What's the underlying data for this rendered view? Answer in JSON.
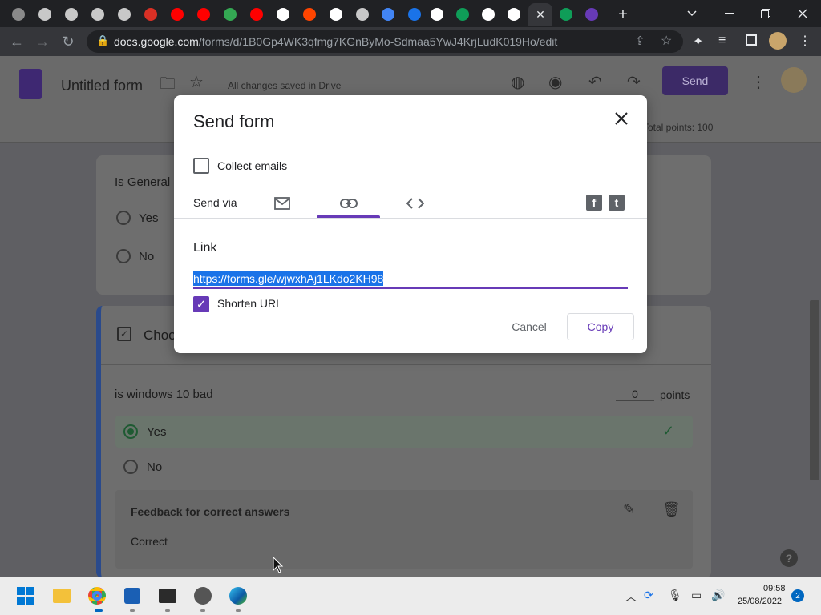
{
  "browser": {
    "url_host": "docs.google.com",
    "url_path": "/forms/d/1B0Gp4WK3qfmg7KGnByMo-Sdmaa5YwJ4KrjLudK019Ho/edit",
    "tabs": [
      {
        "icon": "tab-icon-1",
        "color": "#8a8a8a"
      },
      {
        "icon": "tab-icon-2",
        "color": "#c8c8c8"
      },
      {
        "icon": "tab-icon-3",
        "color": "#c8c8c8"
      },
      {
        "icon": "tab-icon-4",
        "color": "#c8c8c8"
      },
      {
        "icon": "tab-icon-5",
        "color": "#c8c8c8"
      },
      {
        "icon": "tab-icon-6",
        "color": "#d93025"
      },
      {
        "icon": "youtube-icon",
        "color": "#ff0000"
      },
      {
        "icon": "youtube-icon",
        "color": "#ff0000"
      },
      {
        "icon": "tab-icon-9",
        "color": "#34a853"
      },
      {
        "icon": "youtube-icon",
        "color": "#ff0000"
      },
      {
        "icon": "google-icon",
        "color": "#ffffff"
      },
      {
        "icon": "reddit-icon",
        "color": "#ff4500"
      },
      {
        "icon": "tab-icon-13",
        "color": "#ffffff"
      },
      {
        "icon": "tab-icon-14",
        "color": "#c8c8c8"
      },
      {
        "icon": "docs-icon",
        "color": "#4285f4"
      },
      {
        "icon": "tab-icon-16",
        "color": "#1a73e8"
      },
      {
        "icon": "google-icon",
        "color": "#ffffff"
      },
      {
        "icon": "tab-icon-18",
        "color": "#0f9d58"
      },
      {
        "icon": "google-icon",
        "color": "#ffffff"
      },
      {
        "icon": "tab-icon-20",
        "color": "#ffffff"
      },
      {
        "icon": "close-icon",
        "color": "#e8eaed"
      },
      {
        "icon": "tab-icon-22",
        "color": "#0f9d58"
      },
      {
        "icon": "forms-icon",
        "color": "#673ab7"
      }
    ]
  },
  "forms": {
    "title": "Untitled form",
    "saved_status": "All changes saved in Drive",
    "send_label": "Send",
    "total_points": "Total points: 100"
  },
  "background": {
    "q1_title": "Is General",
    "q1_options": [
      "Yes",
      "No"
    ],
    "section_title": "Choo",
    "q2_title": "is windows 10 bad",
    "q2_points_value": "0",
    "q2_points_label": "points",
    "q2_options": [
      "Yes",
      "No"
    ],
    "feedback_title": "Feedback for correct answers",
    "feedback_text": "Correct"
  },
  "dialog": {
    "title": "Send form",
    "collect_emails_label": "Collect emails",
    "collect_emails_checked": false,
    "send_via_label": "Send via",
    "link_heading": "Link",
    "link_url": "https://forms.gle/wjwxhAj1LKdo2KH98",
    "shorten_url_label": "Shorten URL",
    "shorten_url_checked": true,
    "cancel_label": "Cancel",
    "copy_label": "Copy",
    "accent_color": "#673ab7"
  },
  "taskbar": {
    "time": "09:58",
    "date": "25/08/2022",
    "notification_count": "2"
  }
}
